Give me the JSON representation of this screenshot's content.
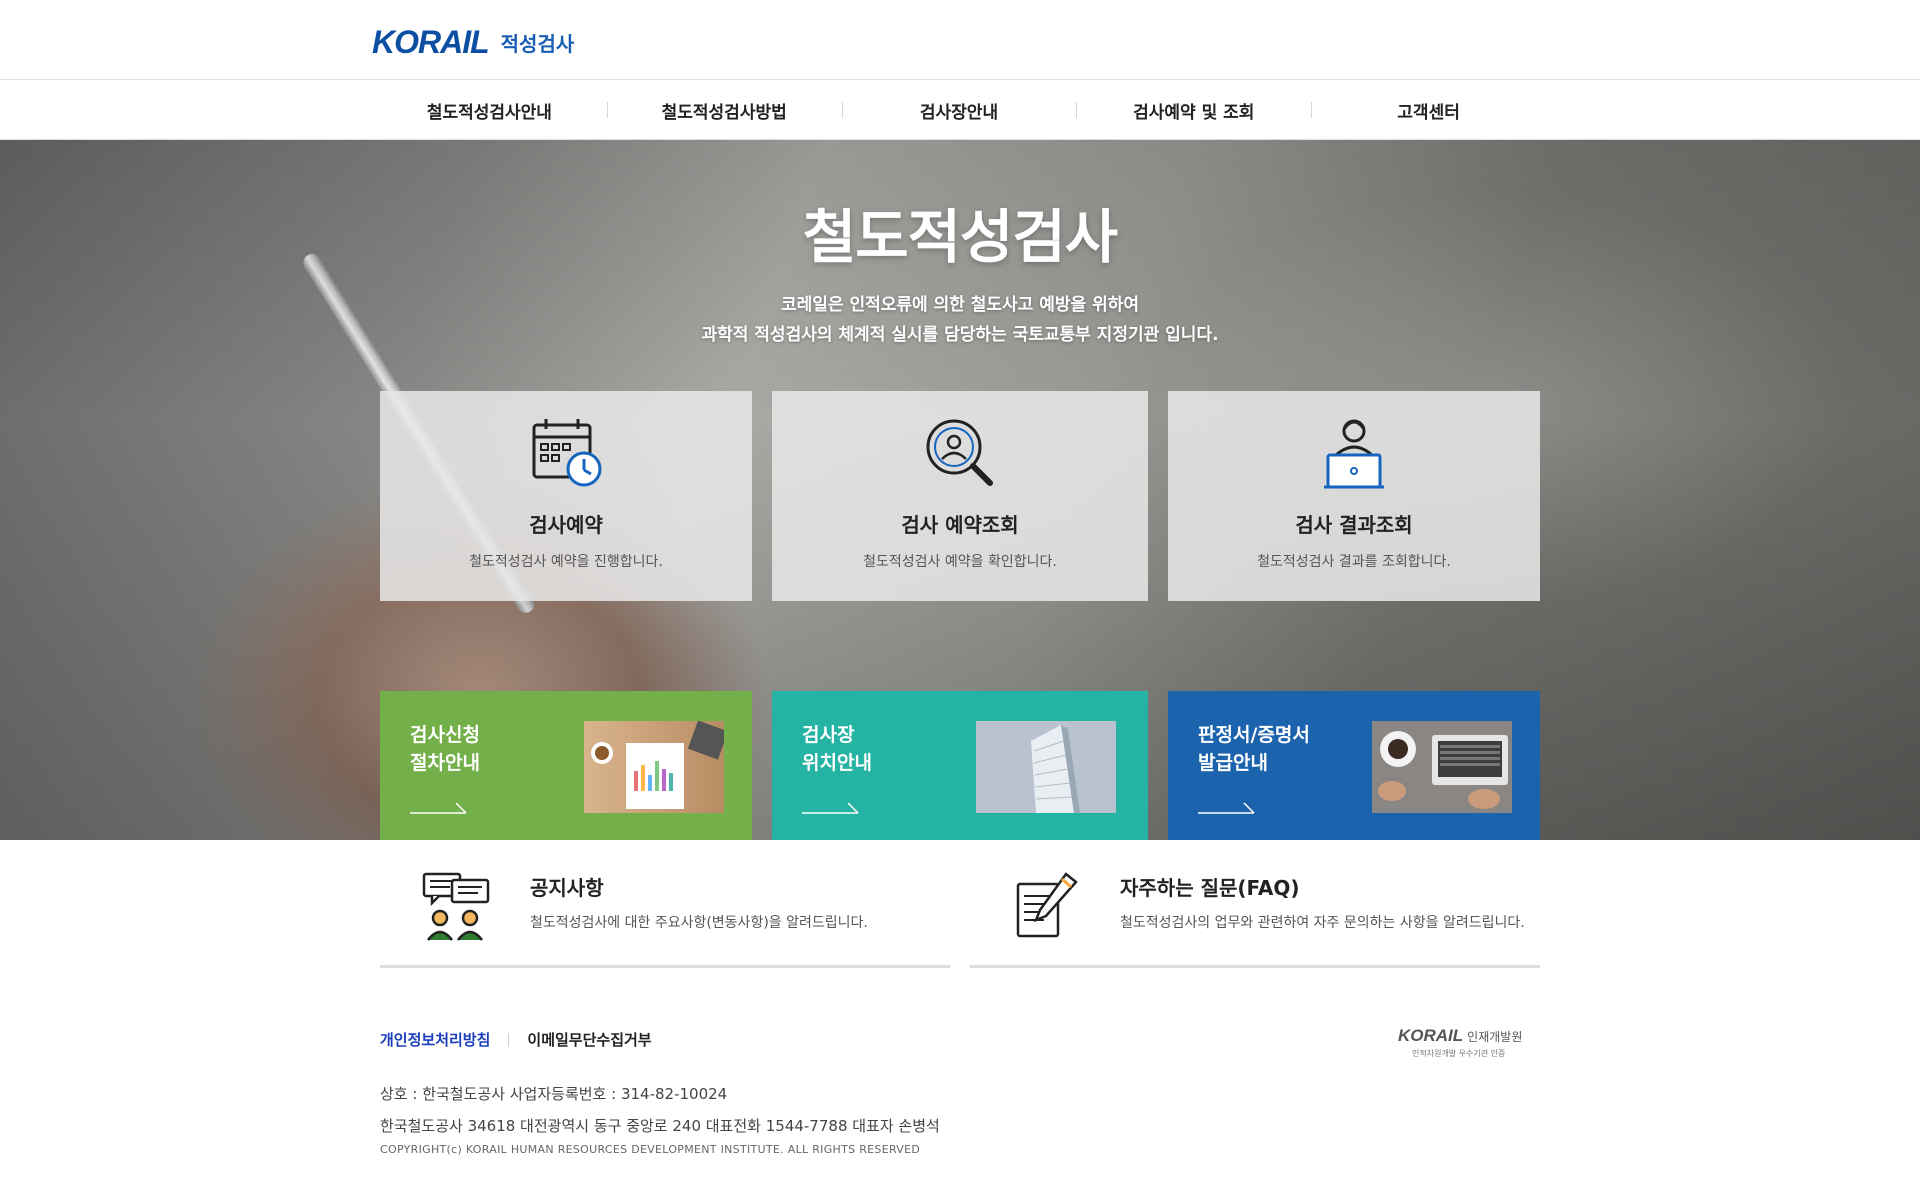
{
  "header": {
    "logo_text": "KORAIL",
    "logo_sub": "적성검사"
  },
  "nav": {
    "items": [
      {
        "label": "철도적성검사안내"
      },
      {
        "label": "철도적성검사방법"
      },
      {
        "label": "검사장안내"
      },
      {
        "label": "검사예약 및 조회"
      },
      {
        "label": "고객센터"
      }
    ]
  },
  "hero": {
    "title": "철도적성검사",
    "desc_line1": "코레일은 인적오류에 의한 철도사고 예방을 위하여",
    "desc_line2": "과학적 적성검사의 체계적 실시를 담당하는 국토교통부 지정기관 입니다."
  },
  "services": [
    {
      "title": "검사예약",
      "desc": "철도적성검사 예약을 진행합니다.",
      "icon": "calendar-clock-icon"
    },
    {
      "title": "검사 예약조회",
      "desc": "철도적성검사 예약을 확인합니다.",
      "icon": "magnifier-person-icon"
    },
    {
      "title": "검사 결과조회",
      "desc": "철도적성검사 결과를 조회합니다.",
      "icon": "person-laptop-icon"
    }
  ],
  "banners": [
    {
      "line1": "검사신청",
      "line2": "절차안내",
      "color": "#74b04a",
      "icon": "arrow-right-icon"
    },
    {
      "line1": "검사장",
      "line2": "위치안내",
      "color": "#25b3a4",
      "icon": "arrow-right-icon"
    },
    {
      "line1": "판정서/증명서",
      "line2": "발급안내",
      "color": "#1b63ad",
      "icon": "arrow-right-icon"
    }
  ],
  "info": {
    "notice": {
      "title": "공지사항",
      "desc": "철도적성검사에 대한 주요사항(변동사항)을 알려드립니다.",
      "icon": "chat-people-icon"
    },
    "faq": {
      "title": "자주하는 질문(FAQ)",
      "desc": "철도적성검사의 업무와 관련하여 자주 문의하는 사항을 알려드립니다.",
      "icon": "document-pen-icon"
    }
  },
  "footer": {
    "privacy": "개인정보처리방침",
    "email_refuse": "이메일무단수집거부",
    "company": "상호 : 한국철도공사 사업자등록번호 : 314-82-10024",
    "address": "한국철도공사 34618 대전광역시 동구 중앙로 240 대표전화 1544-7788 대표자 손병석",
    "copyright": "COPYRIGHT(c) KORAIL HUMAN RESOURCES DEVELOPMENT INSTITUTE. ALL RIGHTS RESERVED",
    "logo_main": "KORAIL",
    "logo_dept": "인재개발원",
    "logo_cert": "인적자원개발 우수기관 인증"
  },
  "colors": {
    "brand": "#0b4ea2",
    "green": "#74b04a",
    "teal": "#25b3a4",
    "blue": "#1b63ad"
  }
}
